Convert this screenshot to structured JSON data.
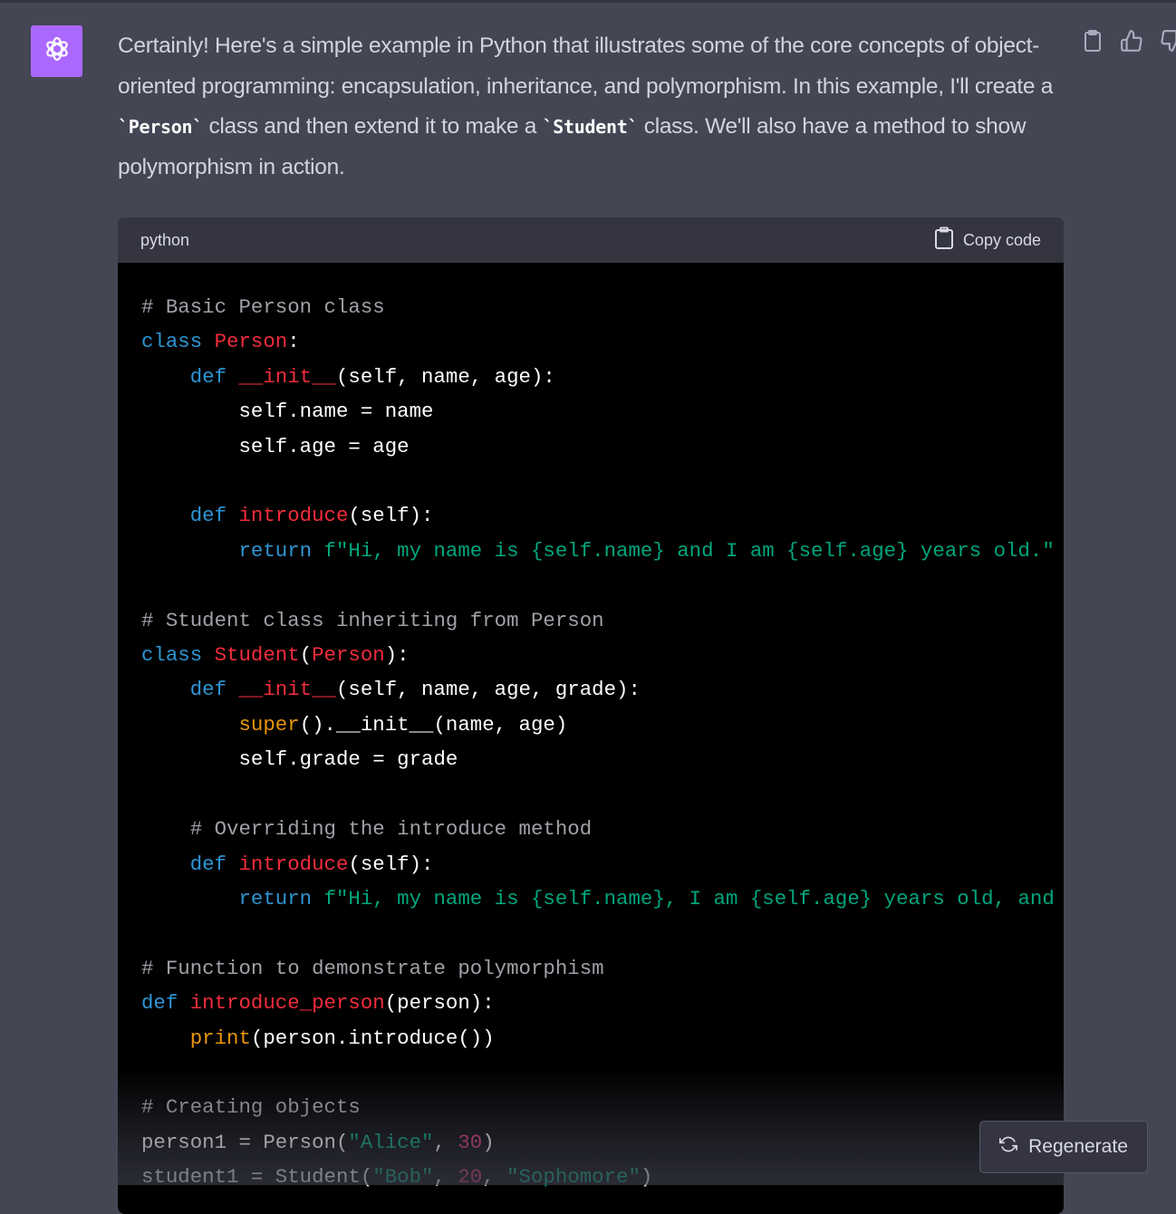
{
  "message": {
    "part1": "Certainly! Here's a simple example in Python that illustrates some of the core concepts of object-oriented programming: encapsulation, inheritance, and polymorphism. In this example, I'll create a ",
    "code1": "`Person`",
    "part2": " class and then extend it to make a ",
    "code2": "`Student`",
    "part3": " class. We'll also have a method to show polymorphism in action."
  },
  "icons": {
    "avatar": "openai-logo-icon",
    "copy": "clipboard-icon",
    "like": "thumbs-up-icon",
    "dislike": "thumbs-down-icon",
    "regenerate": "refresh-icon"
  },
  "code_block": {
    "language": "python",
    "copy_label": "Copy code",
    "lines": [
      [
        [
          "c",
          "# Basic Person class"
        ]
      ],
      [
        [
          "k",
          "class "
        ],
        [
          "t",
          "Person"
        ],
        [
          "",
          ":"
        ]
      ],
      [
        [
          "",
          "    "
        ],
        [
          "k",
          "def "
        ],
        [
          "t",
          "__init__"
        ],
        [
          "",
          "(self, name, age):"
        ]
      ],
      [
        [
          "",
          "        self.name = name"
        ]
      ],
      [
        [
          "",
          "        self.age = age"
        ]
      ],
      [],
      [
        [
          "",
          "    "
        ],
        [
          "k",
          "def "
        ],
        [
          "t",
          "introduce"
        ],
        [
          "",
          "(self):"
        ]
      ],
      [
        [
          "",
          "        "
        ],
        [
          "k",
          "return "
        ],
        [
          "s",
          "f\"Hi, my name is {self.name} and I am {self.age} years old.\""
        ]
      ],
      [],
      [
        [
          "c",
          "# Student class inheriting from Person"
        ]
      ],
      [
        [
          "k",
          "class "
        ],
        [
          "t",
          "Student"
        ],
        [
          "",
          "("
        ],
        [
          "t",
          "Person"
        ],
        [
          "",
          "):"
        ]
      ],
      [
        [
          "",
          "    "
        ],
        [
          "k",
          "def "
        ],
        [
          "t",
          "__init__"
        ],
        [
          "",
          "(self, name, age, grade):"
        ]
      ],
      [
        [
          "",
          "        "
        ],
        [
          "b",
          "super"
        ],
        [
          "",
          "().__init__(name, age)"
        ]
      ],
      [
        [
          "",
          "        self.grade = grade"
        ]
      ],
      [],
      [
        [
          "c",
          "    # Overriding the introduce method"
        ]
      ],
      [
        [
          "",
          "    "
        ],
        [
          "k",
          "def "
        ],
        [
          "t",
          "introduce"
        ],
        [
          "",
          "(self):"
        ]
      ],
      [
        [
          "",
          "        "
        ],
        [
          "k",
          "return "
        ],
        [
          "s",
          "f\"Hi, my name is {self.name}, I am {self.age} years old, and"
        ]
      ],
      [],
      [
        [
          "c",
          "# Function to demonstrate polymorphism"
        ]
      ],
      [
        [
          "k",
          "def "
        ],
        [
          "t",
          "introduce_person"
        ],
        [
          "",
          "(person):"
        ]
      ],
      [
        [
          "",
          "    "
        ],
        [
          "b",
          "print"
        ],
        [
          "",
          "(person.introduce())"
        ]
      ],
      [],
      [
        [
          "c",
          "# Creating objects"
        ]
      ],
      [
        [
          "",
          "person1 = Person("
        ],
        [
          "s",
          "\"Alice\""
        ],
        [
          "",
          ", "
        ],
        [
          "n",
          "30"
        ],
        [
          "",
          ")"
        ]
      ],
      [
        [
          "",
          "student1 = Student("
        ],
        [
          "s",
          "\"Bob\""
        ],
        [
          "",
          ", "
        ],
        [
          "n",
          "20"
        ],
        [
          "",
          ", "
        ],
        [
          "s",
          "\"Sophomore\""
        ],
        [
          "",
          ")"
        ]
      ]
    ]
  },
  "regenerate_label": "Regenerate"
}
